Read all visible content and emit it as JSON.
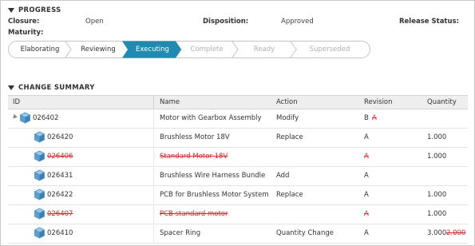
{
  "progress": {
    "header": "PROGRESS",
    "closure_label": "Closure:",
    "closure_value": "Open",
    "disposition_label": "Disposition:",
    "disposition_value": "Approved",
    "release_label": "Release Status:",
    "maturity_label": "Maturity:",
    "steps": [
      {
        "label": "Elaborating",
        "state": "done"
      },
      {
        "label": "Reviewing",
        "state": "done"
      },
      {
        "label": "Executing",
        "state": "current"
      },
      {
        "label": "Complete",
        "state": "future"
      },
      {
        "label": "Ready",
        "state": "future"
      },
      {
        "label": "Superseded",
        "state": "future"
      }
    ],
    "colors": {
      "current": "#1f8bb0",
      "future_text": "#b0b0b0",
      "done_text": "#333333"
    }
  },
  "summary": {
    "header": "CHANGE SUMMARY",
    "columns": [
      "ID",
      "Name",
      "Action",
      "Revision",
      "Quantity"
    ],
    "rows": [
      {
        "id": "026402",
        "name": "Motor with Gearbox Assembly",
        "action": "Modify",
        "revision": "B",
        "revision_old": "A",
        "quantity": "",
        "quantity_old": "",
        "removed": false,
        "level": 0,
        "expandable": true
      },
      {
        "id": "026420",
        "name": "Brushless Motor 18V",
        "action": "Replace",
        "revision": "A",
        "revision_old": "",
        "quantity": "1.000",
        "quantity_old": "",
        "removed": false,
        "level": 1,
        "expandable": false
      },
      {
        "id": "026406",
        "name": "Standard Motor 18V",
        "action": "",
        "revision": "A",
        "revision_old": "",
        "quantity": "1.000",
        "quantity_old": "",
        "removed": true,
        "level": 1,
        "expandable": false
      },
      {
        "id": "026431",
        "name": "Brushless Wire Harness Bundle",
        "action": "Add",
        "revision": "A",
        "revision_old": "",
        "quantity": "",
        "quantity_old": "",
        "removed": false,
        "level": 1,
        "expandable": false
      },
      {
        "id": "026422",
        "name": "PCB for Brushless Motor System",
        "action": "Replace",
        "revision": "A",
        "revision_old": "",
        "quantity": "1.000",
        "quantity_old": "",
        "removed": false,
        "level": 1,
        "expandable": false
      },
      {
        "id": "026407",
        "name": "PCB standard motor",
        "action": "",
        "revision": "A",
        "revision_old": "",
        "quantity": "1.000",
        "quantity_old": "",
        "removed": true,
        "level": 1,
        "expandable": false
      },
      {
        "id": "026410",
        "name": "Spacer Ring",
        "action": "Quantity Change",
        "revision": "A",
        "revision_old": "",
        "quantity": "3.000",
        "quantity_old": "2.000",
        "removed": false,
        "level": 1,
        "expandable": false
      }
    ],
    "colors": {
      "removed": "#d9262a",
      "icon": "#4a8fc2"
    }
  }
}
